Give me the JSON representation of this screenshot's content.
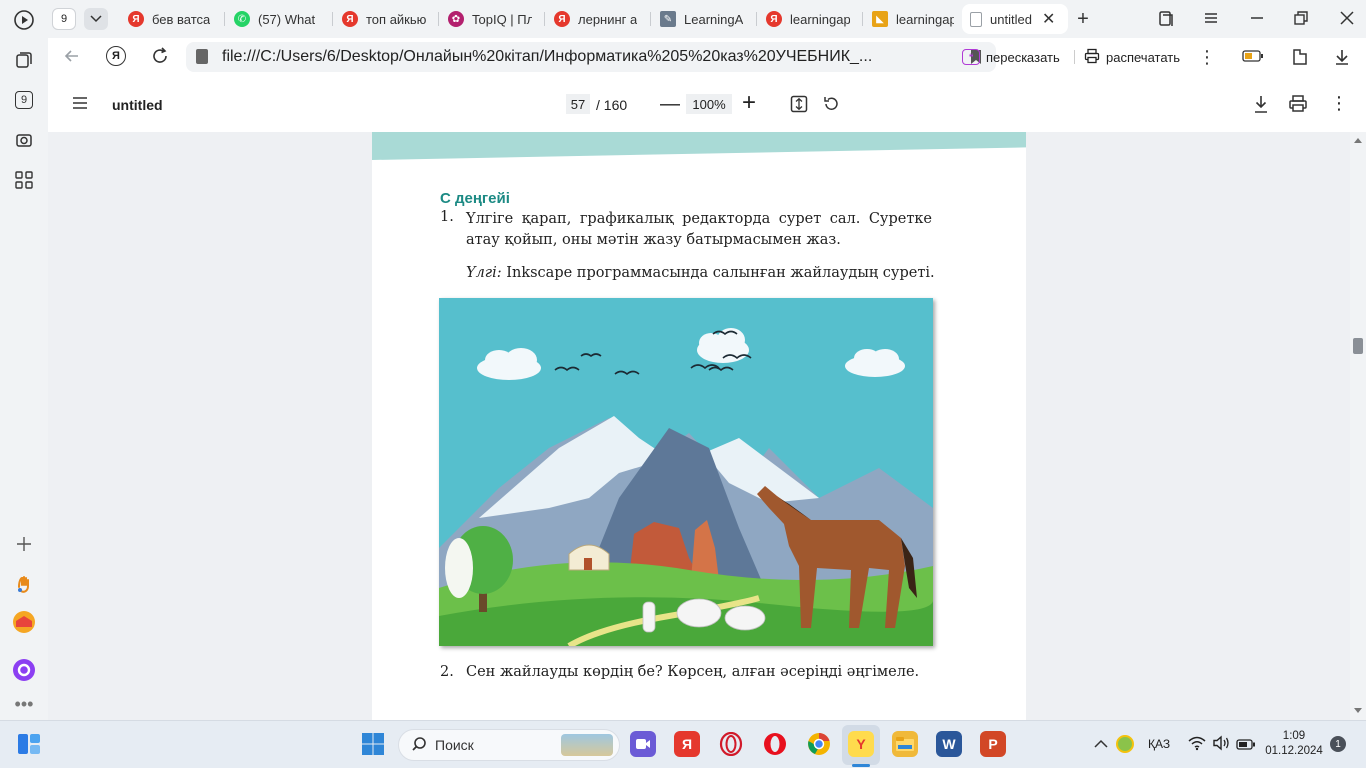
{
  "tabs": {
    "counter": "9",
    "items": [
      {
        "title": "бев ватса",
        "favicon": "yandex-icon",
        "color": "#e5382d",
        "active": false
      },
      {
        "title": "(57) What",
        "favicon": "whatsapp-icon",
        "color": "#25d366",
        "active": false
      },
      {
        "title": "топ айкью",
        "favicon": "yandex-icon",
        "color": "#e5382d",
        "active": false
      },
      {
        "title": "TopIQ | Пл",
        "favicon": "topiq-icon",
        "color": "#b3206e",
        "active": false
      },
      {
        "title": "лернинг а",
        "favicon": "yandex-icon",
        "color": "#e5382d",
        "active": false
      },
      {
        "title": "LearningA",
        "favicon": "learningapps-icon",
        "color": "#6a7a8c",
        "active": false
      },
      {
        "title": "learningap",
        "favicon": "yandex-icon",
        "color": "#e5382d",
        "active": false
      },
      {
        "title": "learningap",
        "favicon": "learningapps-flag-icon",
        "color": "#e8a317",
        "active": false
      },
      {
        "title": "untitled",
        "favicon": "file-icon",
        "color": "#9aa0a6",
        "active": true
      }
    ]
  },
  "address": {
    "url": "file:///C:/Users/6/Desktop/Онлайын%20кітап/Информатика%205%20каз%20УЧЕБНИК_..."
  },
  "actions": {
    "retell": "перескaзать",
    "print": "распечатать"
  },
  "pdf": {
    "title": "untitled",
    "page_current": "57",
    "page_total": "/ 160",
    "zoom": "100%"
  },
  "book": {
    "level_heading": "С деңгейі",
    "task1_num": "1.",
    "task1_text": "Үлгіге қарап, графикалық редакторда сурет сал. Суретке атау қойып, оны мәтін жазу батырмасымен жаз.",
    "sample_label": "Үлгі:",
    "sample_text": " Inkscape программасында салынған жайлаудың суреті.",
    "task2_num": "2.",
    "task2_text": "Сен жайлауды көрдің бе? Көрсең, алған әсеріңді әңгімеле."
  },
  "taskbar": {
    "search_placeholder": "Поиск",
    "language": "ҚАЗ",
    "time": "1:09",
    "date": "01.12.2024",
    "notification_count": "1"
  },
  "colors": {
    "accent_teal": "#1c8a84",
    "band": "#a9dad6",
    "sky": "#56bfcd"
  }
}
